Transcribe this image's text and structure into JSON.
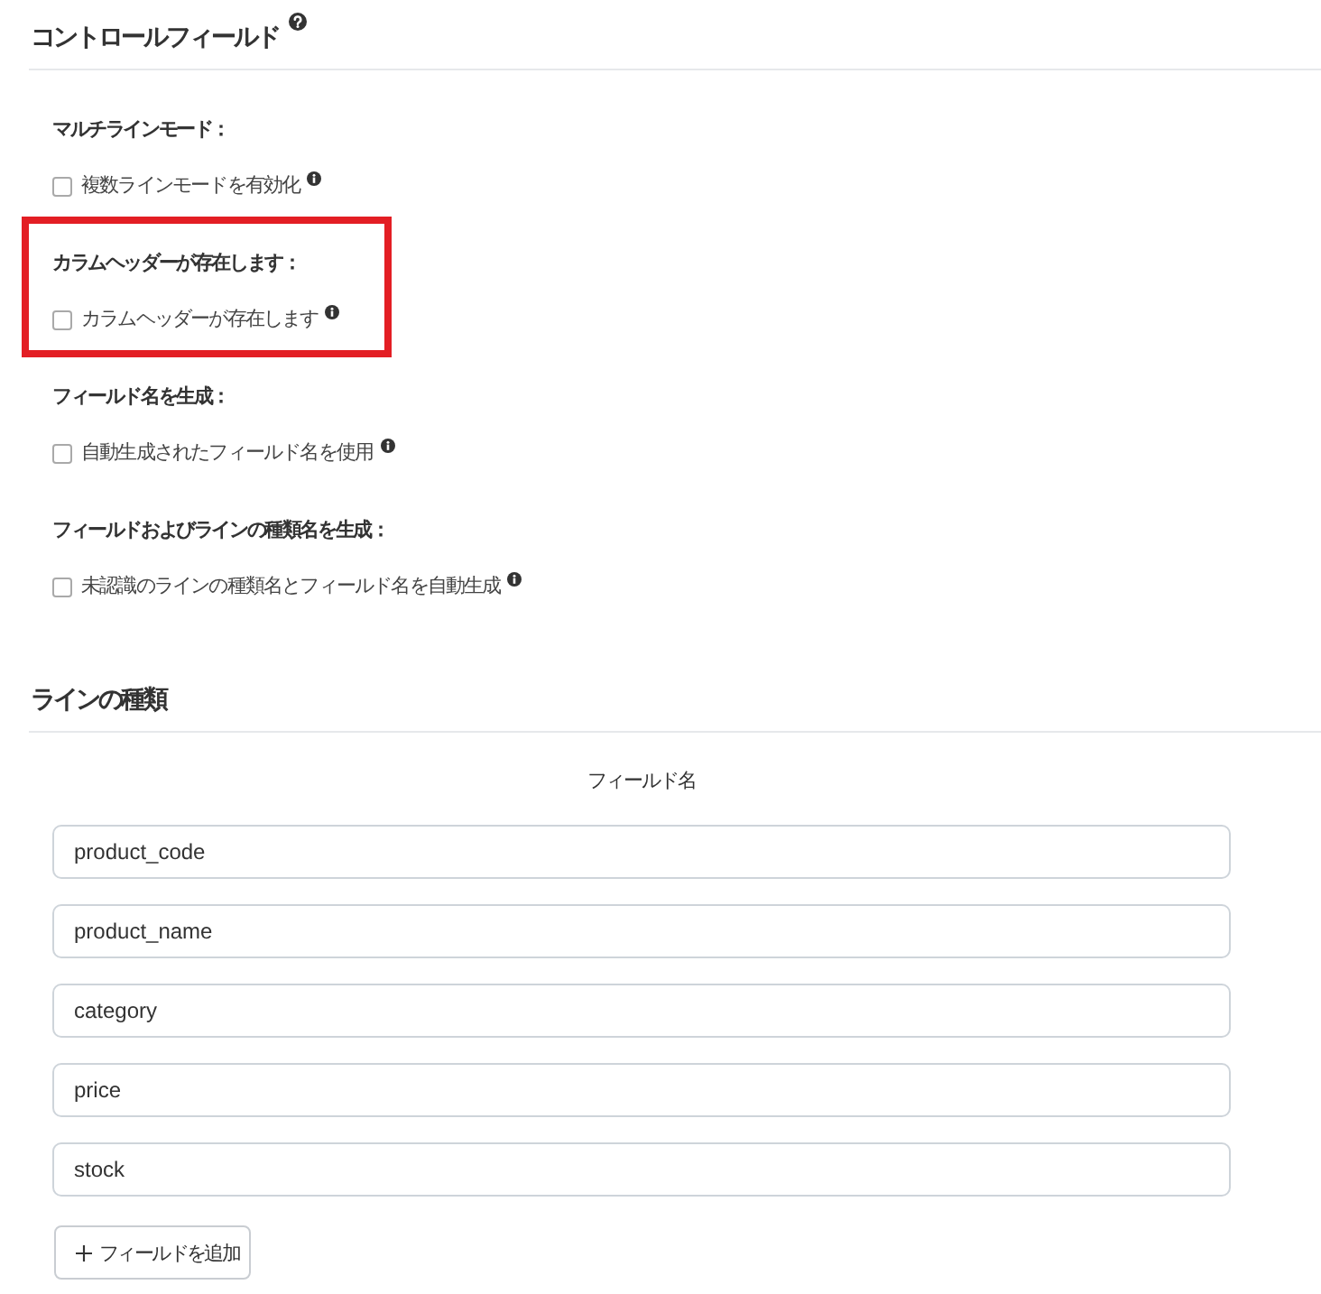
{
  "control_fields": {
    "title": "コントロールフィールド",
    "help": true,
    "options": [
      {
        "heading": "マルチラインモード：",
        "label": "複数ラインモードを有効化",
        "checked": false,
        "highlighted": false
      },
      {
        "heading": "カラムヘッダーが存在します：",
        "label": "カラムヘッダーが存在します",
        "checked": false,
        "highlighted": true
      },
      {
        "heading": "フィールド名を生成：",
        "label": "自動生成されたフィールド名を使用",
        "checked": false,
        "highlighted": false
      },
      {
        "heading": "フィールドおよびラインの種類名を生成：",
        "label": "未認識のラインの種類名とフィールド名を自動生成",
        "checked": false,
        "highlighted": false
      }
    ]
  },
  "line_types": {
    "title": "ラインの種類",
    "column_header": "フィールド名",
    "fields": [
      "product_code",
      "product_name",
      "category",
      "price",
      "stock"
    ],
    "add_button": "フィールドを追加"
  }
}
